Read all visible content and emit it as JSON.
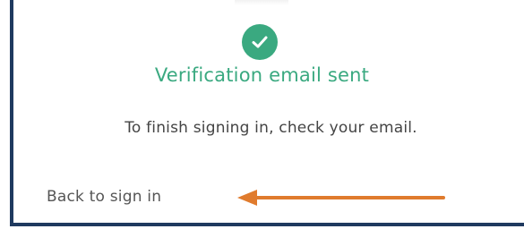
{
  "verification": {
    "title": "Verification email sent",
    "message": "To finish signing in, check your email.",
    "back_link": "Back to sign in",
    "status_icon": "check-circle-icon",
    "annotation_icon": "arrow-left-icon"
  },
  "colors": {
    "success": "#3aa980",
    "frame": "#1f3a5f",
    "arrow": "#e07b2d",
    "text": "#444444"
  }
}
